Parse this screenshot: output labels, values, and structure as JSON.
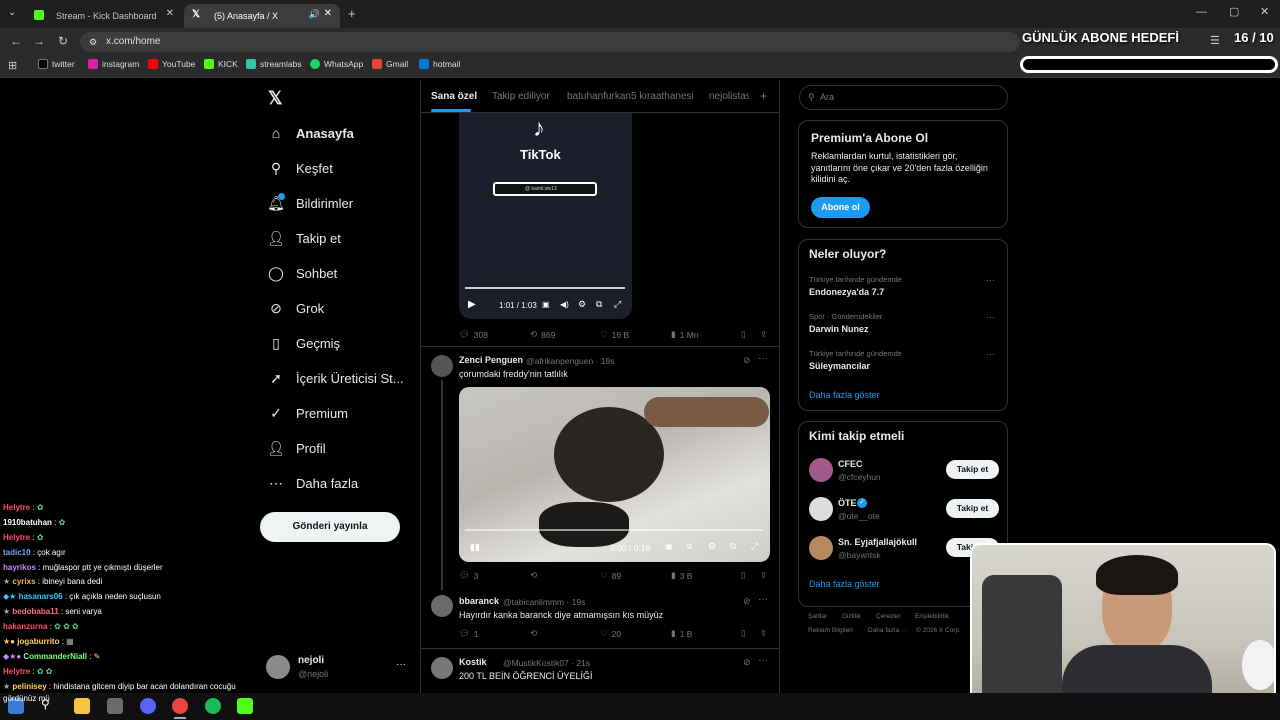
{
  "browser": {
    "tabs": [
      {
        "title": "Stream - Kick Dashboard"
      },
      {
        "title": "(5) Anasayfa / X"
      }
    ],
    "url": "x.com/home",
    "bookmarks": [
      "twitter",
      "instagram",
      "YouTube",
      "KICK",
      "streamlabs",
      "WhatsApp",
      "Gmail",
      "hotmail"
    ]
  },
  "overlay": {
    "goal_label": "GÜNLÜK ABONE HEDEFİ",
    "goal_count": "16 / 10"
  },
  "sidebar": {
    "items": [
      {
        "label": "Anasayfa",
        "icon": "home-icon"
      },
      {
        "label": "Keşfet",
        "icon": "search-icon"
      },
      {
        "label": "Bildirimler",
        "icon": "bell-icon"
      },
      {
        "label": "Takip et",
        "icon": "follow-icon"
      },
      {
        "label": "Sohbet",
        "icon": "chat-icon"
      },
      {
        "label": "Grok",
        "icon": "grok-icon"
      },
      {
        "label": "Geçmiş",
        "icon": "bookmark-icon"
      },
      {
        "label": "İçerik Üreticisi St...",
        "icon": "rocket-icon"
      },
      {
        "label": "Premium",
        "icon": "premium-icon"
      },
      {
        "label": "Profil",
        "icon": "profile-icon"
      },
      {
        "label": "Daha fazla",
        "icon": "more-icon"
      }
    ],
    "post_button": "Gönderi yayınla",
    "account": {
      "name": "nejoli",
      "handle": "@nejoli"
    }
  },
  "feed_tabs": [
    "Sana özel",
    "Takip ediliyor",
    "batuhanfurkan5 kıraathanesi",
    "nejolistas"
  ],
  "video1": {
    "brand": "TikTok",
    "search_text": "@ kamil.ste13",
    "time": "1:01 / 1:03",
    "actions": {
      "replies": "308",
      "reposts": "869",
      "likes": "16 B",
      "views": "1 Mn"
    }
  },
  "tweets": [
    {
      "name": "Zenci Penguen",
      "handle": "@afrikanpenguen · 19s",
      "text": "çorumdaki freddy'nin tatlılık",
      "video_time": "0:00 / 0:18",
      "actions": {
        "replies": "3",
        "reposts": "",
        "likes": "89",
        "views": "3 B"
      }
    },
    {
      "name": "bbaranck",
      "handle": "@tabicanlimmm · 19s",
      "text": "Hayırdır kanka baranck diye atmamışsın kıs müyüz",
      "actions": {
        "replies": "1",
        "reposts": "",
        "likes": "20",
        "views": "1 B"
      }
    },
    {
      "name": "Kostik",
      "handle": "@MustikKostik07 · 21s",
      "text": "200 TL BEİN ÖĞRENCİ ÜYELİĞİ"
    }
  ],
  "right": {
    "search_placeholder": "Ara",
    "premium": {
      "title": "Premium'a Abone Ol",
      "text": "Reklamlardan kurtul, istatistikleri gör, yanıtlarını öne çıkar ve 20'den fazla özelliğin kilidini aç.",
      "button": "Abone ol"
    },
    "trends": {
      "title": "Neler oluyor?",
      "items": [
        {
          "sub": "Türkiye tarihinde gündemde",
          "title": "Endonezya'da 7.7"
        },
        {
          "sub": "Spor · Gündemdekiler",
          "title": "Darwin Nunez"
        },
        {
          "sub": "Türkiye tarihinde gündemde",
          "title": "Süleymancılar"
        }
      ],
      "more": "Daha fazla göster"
    },
    "who": {
      "title": "Kimi takip etmeli",
      "items": [
        {
          "name": "CFEC",
          "handle": "@cfceyhun"
        },
        {
          "name": "ÖTE",
          "handle": "@ote__ote"
        },
        {
          "name": "Sn. Eyjafjallajökull",
          "handle": "@bayantsk"
        }
      ],
      "button": "Takip et",
      "more": "Daha fazla göster"
    },
    "footer": [
      "Şartlar",
      "Gizlilik",
      "Çerezler",
      "Erişilebilirlik",
      "Reklam Bilgileri",
      "Daha fazla ···",
      "© 2026 X Corp."
    ]
  },
  "chat": [
    {
      "user": "Helytre",
      "msg": ":",
      "color": "#ff4d6d"
    },
    {
      "user": "1910batuhan",
      "msg": ":",
      "color": "#ffffff"
    },
    {
      "user": "Helytre",
      "msg": ":",
      "color": "#ff4d6d"
    },
    {
      "user": "tadic10",
      "msg": ": çok agır",
      "color": "#6ea8ff"
    },
    {
      "user": "hayrikos",
      "msg": ": muğlaspor ptt ye çıkmıştı düşerler",
      "color": "#c58aff"
    },
    {
      "user": "cyrixs",
      "msg": ": ibineyi bana dedi",
      "color": "#ffb347"
    },
    {
      "user": "hasanars06",
      "msg": ": çık açıkla neden suçlusun",
      "color": "#38c7ff"
    },
    {
      "user": "bedobaba11",
      "msg": ": seni varya",
      "color": "#ff6a8a"
    },
    {
      "user": "hakanzurna",
      "msg": ":",
      "color": "#ff4d6d"
    },
    {
      "user": "jogaburrito",
      "msg": ":",
      "color": "#ffd35c"
    },
    {
      "user": "CommanderNiall",
      "msg": ":",
      "color": "#7cff7c"
    },
    {
      "user": "Helytre",
      "msg": ":",
      "color": "#ff4d6d"
    },
    {
      "user": "pelinisey",
      "msg": ": hindistana gitcem diyip bar acan dolandıran cocuğu",
      "color": "#ffd35c"
    },
    {
      "user": "",
      "msg": "gördünüz mü",
      "color": "#ffffff"
    }
  ]
}
